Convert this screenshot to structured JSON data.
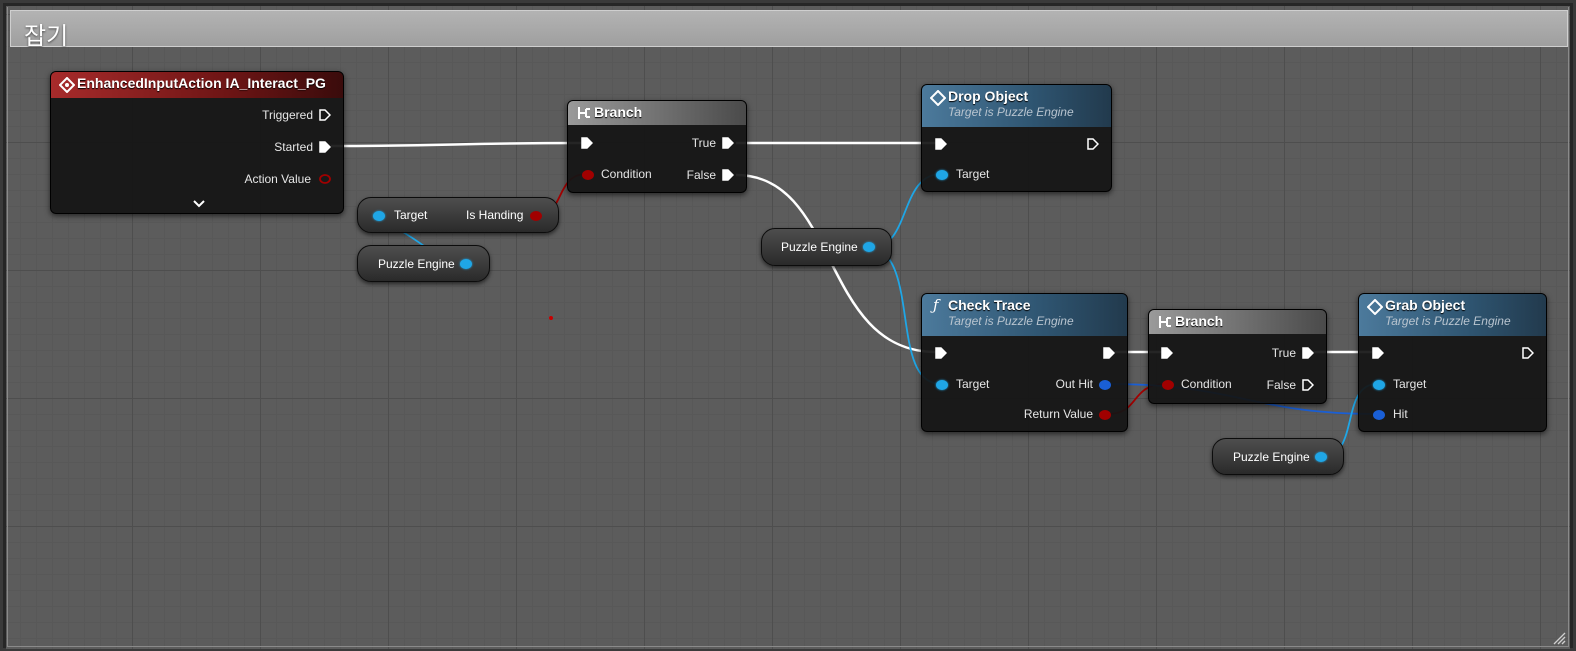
{
  "comment": {
    "title": "잡기"
  },
  "event_node": {
    "title": "EnhancedInputAction IA_Interact_PG",
    "pins": {
      "triggered": "Triggered",
      "started": "Started",
      "action_value": "Action Value"
    }
  },
  "is_handing_node": {
    "target": "Target",
    "output": "Is Handing"
  },
  "branch_1": {
    "title": "Branch",
    "condition": "Condition",
    "true": "True",
    "false": "False"
  },
  "drop_object": {
    "title": "Drop Object",
    "subtitle": "Target is Puzzle Engine",
    "target": "Target"
  },
  "check_trace": {
    "title": "Check Trace",
    "subtitle": "Target is Puzzle Engine",
    "target": "Target",
    "out_hit": "Out Hit",
    "return_value": "Return Value"
  },
  "branch_2": {
    "title": "Branch",
    "condition": "Condition",
    "true": "True",
    "false": "False"
  },
  "grab_object": {
    "title": "Grab Object",
    "subtitle": "Target is Puzzle Engine",
    "target": "Target",
    "hit": "Hit"
  },
  "var_nodes": {
    "puzzle_engine_1": "Puzzle Engine",
    "puzzle_engine_2": "Puzzle Engine",
    "puzzle_engine_3": "Puzzle Engine"
  },
  "colors": {
    "exec_wire": "#ffffff",
    "object_wire": "#1fa6e6",
    "bool_wire": "#a10000",
    "struct_wire": "#1a5fd6"
  },
  "icons": {
    "event": "event-diamond-icon",
    "function_call": "function-diamond-icon",
    "function_f": "function-f-icon",
    "branch": "branch-icon",
    "expand": "chevron-down-icon"
  }
}
